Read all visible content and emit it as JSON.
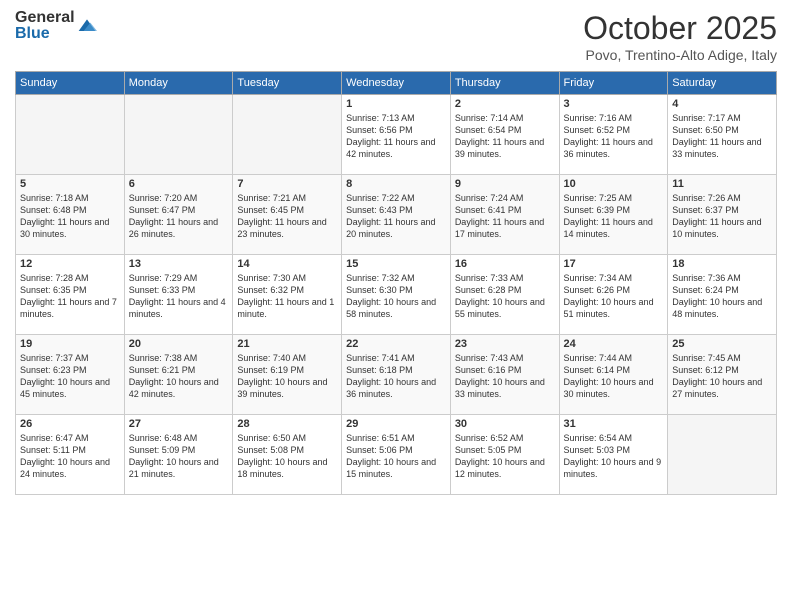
{
  "logo": {
    "general": "General",
    "blue": "Blue"
  },
  "header": {
    "month": "October 2025",
    "location": "Povo, Trentino-Alto Adige, Italy"
  },
  "weekdays": [
    "Sunday",
    "Monday",
    "Tuesday",
    "Wednesday",
    "Thursday",
    "Friday",
    "Saturday"
  ],
  "weeks": [
    [
      {
        "day": "",
        "empty": true
      },
      {
        "day": "",
        "empty": true
      },
      {
        "day": "",
        "empty": true
      },
      {
        "day": "1",
        "sunrise": "7:13 AM",
        "sunset": "6:56 PM",
        "daylight": "11 hours and 42 minutes."
      },
      {
        "day": "2",
        "sunrise": "7:14 AM",
        "sunset": "6:54 PM",
        "daylight": "11 hours and 39 minutes."
      },
      {
        "day": "3",
        "sunrise": "7:16 AM",
        "sunset": "6:52 PM",
        "daylight": "11 hours and 36 minutes."
      },
      {
        "day": "4",
        "sunrise": "7:17 AM",
        "sunset": "6:50 PM",
        "daylight": "11 hours and 33 minutes."
      }
    ],
    [
      {
        "day": "5",
        "sunrise": "7:18 AM",
        "sunset": "6:48 PM",
        "daylight": "11 hours and 30 minutes."
      },
      {
        "day": "6",
        "sunrise": "7:20 AM",
        "sunset": "6:47 PM",
        "daylight": "11 hours and 26 minutes."
      },
      {
        "day": "7",
        "sunrise": "7:21 AM",
        "sunset": "6:45 PM",
        "daylight": "11 hours and 23 minutes."
      },
      {
        "day": "8",
        "sunrise": "7:22 AM",
        "sunset": "6:43 PM",
        "daylight": "11 hours and 20 minutes."
      },
      {
        "day": "9",
        "sunrise": "7:24 AM",
        "sunset": "6:41 PM",
        "daylight": "11 hours and 17 minutes."
      },
      {
        "day": "10",
        "sunrise": "7:25 AM",
        "sunset": "6:39 PM",
        "daylight": "11 hours and 14 minutes."
      },
      {
        "day": "11",
        "sunrise": "7:26 AM",
        "sunset": "6:37 PM",
        "daylight": "11 hours and 10 minutes."
      }
    ],
    [
      {
        "day": "12",
        "sunrise": "7:28 AM",
        "sunset": "6:35 PM",
        "daylight": "11 hours and 7 minutes."
      },
      {
        "day": "13",
        "sunrise": "7:29 AM",
        "sunset": "6:33 PM",
        "daylight": "11 hours and 4 minutes."
      },
      {
        "day": "14",
        "sunrise": "7:30 AM",
        "sunset": "6:32 PM",
        "daylight": "11 hours and 1 minute."
      },
      {
        "day": "15",
        "sunrise": "7:32 AM",
        "sunset": "6:30 PM",
        "daylight": "10 hours and 58 minutes."
      },
      {
        "day": "16",
        "sunrise": "7:33 AM",
        "sunset": "6:28 PM",
        "daylight": "10 hours and 55 minutes."
      },
      {
        "day": "17",
        "sunrise": "7:34 AM",
        "sunset": "6:26 PM",
        "daylight": "10 hours and 51 minutes."
      },
      {
        "day": "18",
        "sunrise": "7:36 AM",
        "sunset": "6:24 PM",
        "daylight": "10 hours and 48 minutes."
      }
    ],
    [
      {
        "day": "19",
        "sunrise": "7:37 AM",
        "sunset": "6:23 PM",
        "daylight": "10 hours and 45 minutes."
      },
      {
        "day": "20",
        "sunrise": "7:38 AM",
        "sunset": "6:21 PM",
        "daylight": "10 hours and 42 minutes."
      },
      {
        "day": "21",
        "sunrise": "7:40 AM",
        "sunset": "6:19 PM",
        "daylight": "10 hours and 39 minutes."
      },
      {
        "day": "22",
        "sunrise": "7:41 AM",
        "sunset": "6:18 PM",
        "daylight": "10 hours and 36 minutes."
      },
      {
        "day": "23",
        "sunrise": "7:43 AM",
        "sunset": "6:16 PM",
        "daylight": "10 hours and 33 minutes."
      },
      {
        "day": "24",
        "sunrise": "7:44 AM",
        "sunset": "6:14 PM",
        "daylight": "10 hours and 30 minutes."
      },
      {
        "day": "25",
        "sunrise": "7:45 AM",
        "sunset": "6:12 PM",
        "daylight": "10 hours and 27 minutes."
      }
    ],
    [
      {
        "day": "26",
        "sunrise": "6:47 AM",
        "sunset": "5:11 PM",
        "daylight": "10 hours and 24 minutes."
      },
      {
        "day": "27",
        "sunrise": "6:48 AM",
        "sunset": "5:09 PM",
        "daylight": "10 hours and 21 minutes."
      },
      {
        "day": "28",
        "sunrise": "6:50 AM",
        "sunset": "5:08 PM",
        "daylight": "10 hours and 18 minutes."
      },
      {
        "day": "29",
        "sunrise": "6:51 AM",
        "sunset": "5:06 PM",
        "daylight": "10 hours and 15 minutes."
      },
      {
        "day": "30",
        "sunrise": "6:52 AM",
        "sunset": "5:05 PM",
        "daylight": "10 hours and 12 minutes."
      },
      {
        "day": "31",
        "sunrise": "6:54 AM",
        "sunset": "5:03 PM",
        "daylight": "10 hours and 9 minutes."
      },
      {
        "day": "",
        "empty": true
      }
    ]
  ]
}
